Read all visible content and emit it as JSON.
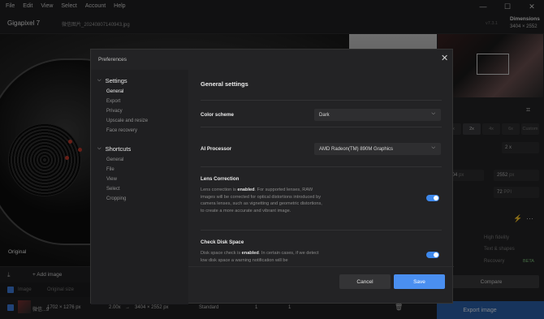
{
  "menubar": {
    "items": [
      "File",
      "Edit",
      "View",
      "Select",
      "Account",
      "Help"
    ]
  },
  "window_controls": {
    "minimize": "—",
    "maximize": "☐",
    "close": "✕"
  },
  "app": {
    "title": "Gigapixel 7",
    "file_name": "微信图片_20240807140943.jpg",
    "version": "v7.3.1",
    "dimensions_label": "Dimensions",
    "dimensions_value": "3404 × 2552"
  },
  "preview": {
    "label": "Original"
  },
  "right_panel": {
    "tabs": [
      "1x",
      "2x",
      "4x",
      "6x",
      "Custom"
    ],
    "scale_value": "2",
    "scale_unit": "x",
    "width": "3404",
    "width_unit": "px",
    "height": "2552",
    "height_unit": "px",
    "dpi": "72",
    "dpi_unit": "PPI",
    "options": [
      "High fidelity",
      "Text & shapes",
      "Recovery"
    ],
    "beta_label": "BETA",
    "compare_label": "Compare",
    "export_label": "Export image"
  },
  "queue": {
    "add_image_label": "Add image",
    "columns": [
      "Image",
      "Original size"
    ],
    "row": {
      "filename": "微信...9",
      "original_size": "1702 × 1276 px",
      "scale": "2.00x",
      "arrow": "→",
      "output_size": "3404 × 2552 px",
      "model": "Standard",
      "c1": "1",
      "c2": "1"
    }
  },
  "preferences": {
    "title": "Preferences",
    "close_symbol": "✕",
    "nav": {
      "settings_group": "Settings",
      "settings_items": [
        "General",
        "Export",
        "Privacy",
        "Upscale and resize",
        "Face recovery"
      ],
      "shortcuts_group": "Shortcuts",
      "shortcuts_items": [
        "General",
        "File",
        "View",
        "Select",
        "Cropping"
      ]
    },
    "content_title": "General settings",
    "color_scheme": {
      "label": "Color scheme",
      "value": "Dark"
    },
    "ai_processor": {
      "label": "AI Processor",
      "value": "AMD Radeon(TM) 890M Graphics"
    },
    "lens_correction": {
      "label": "Lens Correction",
      "desc_pre": "Lens correction is ",
      "desc_bold": "enabled",
      "desc_post": ". For supported lenses, RAW images will be corrected for optical distortions introduced by camera lenses, such as vignetting and geometric distortions, to create a more accurate and vibrant image.",
      "enabled": true
    },
    "check_disk_space": {
      "label": "Check Disk Space",
      "desc_pre": "Disk space check is ",
      "desc_bold": "enabled",
      "desc_post": ". In certain cases, if we detect low disk space a warning notification will be",
      "enabled": true
    },
    "cancel_label": "Cancel",
    "save_label": "Save"
  }
}
